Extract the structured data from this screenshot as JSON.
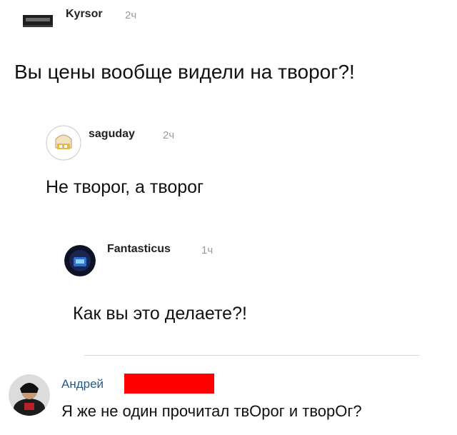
{
  "comments": [
    {
      "author": "Kyrsor",
      "time": "2ч",
      "text": "Вы цены вообще видели на творог?!"
    },
    {
      "author": "saguday",
      "time": "2ч",
      "text": "Не творог, а творог"
    },
    {
      "author": "Fantasticus",
      "time": "1ч",
      "text": "Как вы это делаете?!"
    },
    {
      "author": "Андрей",
      "time": "",
      "text": "Я же не один прочитал твОрог и творОг?"
    }
  ],
  "colors": {
    "redaction": "#ff0000",
    "time": "#9a9a9a",
    "link": "#2a5885"
  }
}
